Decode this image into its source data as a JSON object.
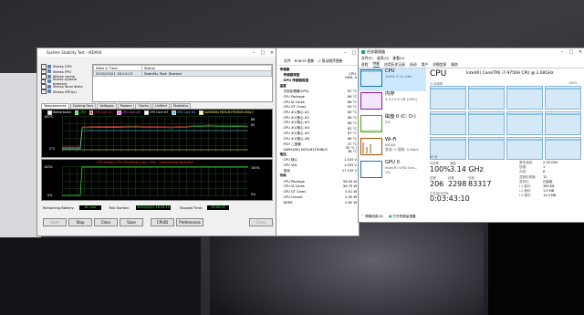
{
  "stability": {
    "title": "System Stability Test - AIDA64",
    "checks": [
      {
        "label": "Stress CPU",
        "checked": true
      },
      {
        "label": "Stress FPU",
        "checked": true
      },
      {
        "label": "Stress cache",
        "checked": false
      },
      {
        "label": "Stress system memory",
        "checked": false
      },
      {
        "label": "Stress local disks",
        "checked": false
      },
      {
        "label": "Stress GPU(s)",
        "checked": false
      }
    ],
    "log_headers": [
      "Date & Time",
      "Status"
    ],
    "log_rows": [
      [
        "2019/10/21 16:24:13",
        "Stability Test: Started"
      ]
    ],
    "tabs": [
      "Temperatures",
      "Cooling Fans",
      "Voltages",
      "Powers",
      "Clocks",
      "Unified",
      "Statistics"
    ],
    "legend": [
      "Motherboard",
      "CPU",
      "CPU Core #1",
      "CPU Core #2",
      "CPU Core #3",
      "CPU Core #4",
      "SAMSUNG MZVLB1T0HBLR-000L7"
    ],
    "legend_colors": [
      "#ffffff",
      "#33ff33",
      "#ff4040",
      "#ff66ff",
      "#ffffff",
      "#66ccff",
      "#ffff66"
    ],
    "temp_axis": {
      "top": "100°C",
      "bottom": "0°C"
    },
    "temp_values": [
      "86",
      "62"
    ],
    "usage_title": "CPU Usage | CPU Throttling (max: 19%) - Overheating Detected!",
    "usage_axis": {
      "top": "100%",
      "bottom": "0%"
    },
    "usage_values": [
      "100%",
      "0%"
    ],
    "bottom": {
      "battery_label": "Remaining Battery:",
      "battery_value": "AC Line",
      "started_label": "Test Started:",
      "started_value": "2019/10/21 16:24:13",
      "elapsed_label": "Elapsed Time:",
      "elapsed_value": "00:00:34"
    },
    "buttons": [
      "Start",
      "Stop",
      "Clear",
      "Save",
      "CPUID",
      "Preferences",
      "Close"
    ]
  },
  "sensor": {
    "toolbar": [
      "文件",
      "BIOS 更新",
      "驱动程序更新"
    ],
    "sections": [
      {
        "label": "传感器",
        "value": ""
      },
      {
        "label": "传感器类型",
        "value": "CPU, HDD, A"
      },
      {
        "label": "GPU 传感器类型",
        "value": ""
      },
      {
        "label": "温度",
        "value": ""
      }
    ],
    "temps": [
      [
        "中央处理器(CPU)",
        "87 °C"
      ],
      [
        "CPU Package",
        "86 °C"
      ],
      [
        "CPU IA Cores",
        "86 °C"
      ],
      [
        "CPU GT Cores",
        "63 °C"
      ],
      [
        "CPU #1/核心 #1",
        "85 °C"
      ],
      [
        "CPU #1/核心 #2",
        "86 °C"
      ],
      [
        "CPU #1/核心 #3",
        "86 °C"
      ],
      [
        "CPU #1/核心 #4",
        "82 °C"
      ],
      [
        "CPU #1/核心 #5",
        "87 °C"
      ],
      [
        "CPU #1/核心 #6",
        "86 °C"
      ],
      [
        "PCH 二极管",
        "37 °C"
      ],
      [
        "SAMSUNG MZVLB1T0HBLR",
        "35 °C / 36 °C"
      ]
    ],
    "volt_header": "电压",
    "volts": [
      [
        "CPU 核心",
        "1.025 V"
      ],
      [
        "CPU VID",
        "1.025 V"
      ],
      [
        "电池",
        "17.105 V"
      ]
    ],
    "power_header": "功耗",
    "powers": [
      [
        "CPU Package",
        "58.93 W"
      ],
      [
        "CPU IA Cores",
        "56.79 W"
      ],
      [
        "CPU GT Cores",
        "0.01 W"
      ],
      [
        "CPU Uncore",
        "0.55 W"
      ],
      [
        "DIMM",
        "0.82 W"
      ]
    ]
  },
  "taskman": {
    "title": "任务管理器",
    "menu": [
      "文件(F)",
      "选项(O)",
      "查看(V)"
    ],
    "tabs": [
      "进程",
      "性能",
      "应用历史记录",
      "启动",
      "用户",
      "详细信息",
      "服务"
    ],
    "side": [
      {
        "name": "CPU",
        "line2": "100% 3.14 GHz",
        "line3": ""
      },
      {
        "name": "内存",
        "line2": "4.1/15.8 GB (26%)",
        "line3": ""
      },
      {
        "name": "磁盘 0 (C: D:)",
        "line2": "0%",
        "line3": ""
      },
      {
        "name": "Wi-Fi",
        "line2": "WLAN",
        "line3": "发送: 0 接收: 0 Kbps"
      },
      {
        "name": "GPU 0",
        "line2": "Intel(R) UHD Gra...",
        "line3": "1%"
      }
    ],
    "side_colors": [
      "#1177bb",
      "#8b12ae",
      "#4da60c",
      "#a74f01",
      "#1177bb"
    ],
    "heading": "CPU",
    "cpu_name": "Intel(R) Core(TM) i7-9750H CPU @ 2.60GHz",
    "graph_label": "% 利用率",
    "graph_top": "100%",
    "graph_span": "60 秒",
    "stats": [
      {
        "label": "利用率",
        "value": "100%"
      },
      {
        "label": "速度",
        "value": "3.14 GHz"
      },
      {
        "label": "进程",
        "value": "206"
      },
      {
        "label": "线程",
        "value": "2298"
      },
      {
        "label": "句柄",
        "value": "83317"
      }
    ],
    "uptime_label": "正常运行时间",
    "uptime": "0:03:43:10",
    "specs": [
      [
        "基准速度:",
        "2.59 GHz"
      ],
      [
        "插槽:",
        "1"
      ],
      [
        "内核:",
        "6"
      ],
      [
        "逻辑处理器:",
        "12"
      ],
      [
        "虚拟化:",
        "已启用"
      ],
      [
        "L1 缓存:",
        "384 KB"
      ],
      [
        "L2 缓存:",
        "1.5 MB"
      ],
      [
        "L3 缓存:",
        "12.0 MB"
      ]
    ],
    "footer": [
      "简略信息(D)",
      "打开资源监视器"
    ]
  }
}
